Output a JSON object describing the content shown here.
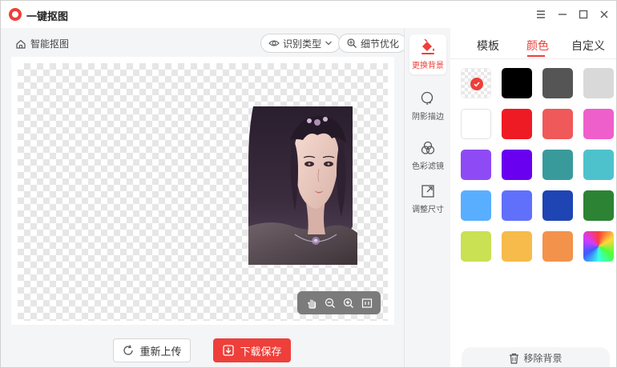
{
  "app": {
    "title": "一键抠图"
  },
  "window_controls": {
    "menu": "☰",
    "minimize": "−",
    "maximize": "□",
    "close": "✕"
  },
  "toolbar": {
    "breadcrumb": "智能抠图",
    "recognize_type": "识别类型",
    "detail_optimize": "细节优化"
  },
  "canvas": {
    "subject": "portrait-cutout"
  },
  "zoom_bar": {
    "tools": [
      "hand-icon",
      "zoom-out-icon",
      "zoom-in-icon",
      "fit-screen-icon"
    ]
  },
  "actions": {
    "reupload": "重新上传",
    "download_save": "下载保存"
  },
  "tools": [
    {
      "label": "更换背景",
      "icon": "paint-bucket-icon",
      "active": true
    },
    {
      "label": "阴影描边",
      "icon": "shadow-outline-icon",
      "active": false
    },
    {
      "label": "色彩滤镜",
      "icon": "color-filter-icon",
      "active": false
    },
    {
      "label": "调整尺寸",
      "icon": "resize-icon",
      "active": false
    }
  ],
  "panel": {
    "tabs": [
      {
        "label": "模板",
        "active": false
      },
      {
        "label": "颜色",
        "active": true
      },
      {
        "label": "自定义",
        "active": false
      }
    ],
    "swatches": [
      {
        "name": "transparent",
        "color": "transparent",
        "selected": true
      },
      {
        "name": "black",
        "color": "#000000"
      },
      {
        "name": "dark-gray",
        "color": "#555555"
      },
      {
        "name": "light-gray",
        "color": "#d9d9d9"
      },
      {
        "name": "white",
        "color": "#ffffff"
      },
      {
        "name": "red",
        "color": "#ee1b24"
      },
      {
        "name": "coral",
        "color": "#ef5959"
      },
      {
        "name": "pink",
        "color": "#ef5fcb"
      },
      {
        "name": "purple",
        "color": "#8e4bf5"
      },
      {
        "name": "violet",
        "color": "#6a00f0"
      },
      {
        "name": "teal",
        "color": "#399a9c"
      },
      {
        "name": "cyan",
        "color": "#4ec2cc"
      },
      {
        "name": "sky-blue",
        "color": "#5aaeff"
      },
      {
        "name": "periwinkle",
        "color": "#6070fb"
      },
      {
        "name": "navy",
        "color": "#1f45b4"
      },
      {
        "name": "green",
        "color": "#2c8334"
      },
      {
        "name": "lime",
        "color": "#c9e152"
      },
      {
        "name": "amber",
        "color": "#f6bb4a"
      },
      {
        "name": "orange",
        "color": "#f3924b"
      },
      {
        "name": "rainbow",
        "color": "gradient"
      }
    ],
    "remove_background": "移除背景"
  },
  "accent_color": "#ee3f3a"
}
